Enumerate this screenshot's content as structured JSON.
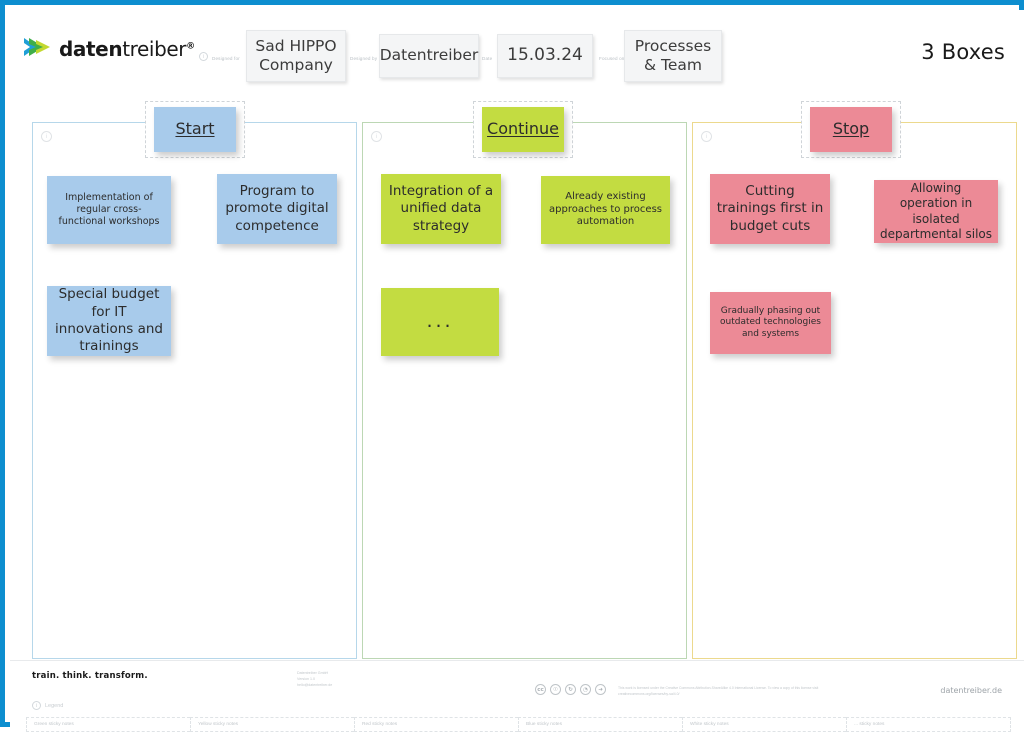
{
  "brand": {
    "logo_bold": "daten",
    "logo_light": "treiber",
    "logo_registered": "®",
    "tagline": "train. think. transform.",
    "website": "datentreiber.de"
  },
  "header": {
    "board_title": "3 Boxes",
    "fields": [
      {
        "label": "Designed for",
        "value": "Sad HIPPO\nCompany",
        "icon": "info-icon"
      },
      {
        "label": "Designed by",
        "value": "Datentreiber"
      },
      {
        "label": "Date",
        "value": "15.03.24"
      },
      {
        "label": "Focused on",
        "value": "Processes\n& Team"
      }
    ]
  },
  "columns": [
    {
      "key": "start",
      "title": "Start",
      "color": "#a8cbeb",
      "border_color": "#b6d7ea",
      "notes": [
        {
          "text": "Implementation of regular cross-functional workshops",
          "size": "small"
        },
        {
          "text": "Program to promote digital competence",
          "size": "large"
        },
        {
          "text": "Special budget for IT innovations and trainings",
          "size": "large"
        }
      ]
    },
    {
      "key": "continue",
      "title": "Continue",
      "color": "#c3dc41",
      "border_color": "#bcd7b4",
      "notes": [
        {
          "text": "Integration of a unified data strategy",
          "size": "large"
        },
        {
          "text": "Already existing approaches to process automation",
          "size": "small"
        },
        {
          "text": "...",
          "size": "dots"
        }
      ]
    },
    {
      "key": "stop",
      "title": "Stop",
      "color": "#ec8a96",
      "border_color": "#ecd98d",
      "notes": [
        {
          "text": "Cutting trainings first in budget cuts",
          "size": "large"
        },
        {
          "text": "Allowing operation in isolated departmental silos",
          "size": "small"
        },
        {
          "text": "Gradually phasing out outdated technologies and systems",
          "size": "tiny"
        }
      ]
    }
  ],
  "notes": {
    "start_1": "Implementation of regular cross-functional workshops",
    "start_2": "Program to promote digital competence",
    "start_3": "Special budget for IT innovations and trainings",
    "continue_1": "Integration of a unified data strategy",
    "continue_2": "Already existing approaches to process automation",
    "continue_3": "...",
    "stop_1": "Cutting trainings first in budget cuts",
    "stop_2": "Allowing operation in isolated departmental silos",
    "stop_3": "Gradually phasing out outdated technologies and systems"
  },
  "footer": {
    "imprint": "Datentreiber GmbH\nVersion 1.0\nhello@datentreiber.de",
    "license": "This work is licensed under the Creative Commons Attribution-ShareAlike 4.0 International License. To view a copy of this license visit creativecommons.org/licenses/by-sa/4.0/",
    "cc_badges": [
      "cc",
      "BY",
      "SA",
      "NC",
      "ND"
    ],
    "legend_label": "Legend",
    "legend_items": [
      "Green sticky notes",
      "Yellow sticky notes",
      "Red sticky notes",
      "Blue sticky notes",
      "White sticky notes",
      "... sticky notes"
    ]
  }
}
